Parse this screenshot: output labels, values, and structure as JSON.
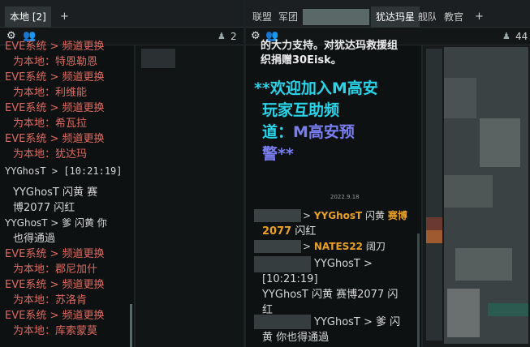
{
  "left_window": {
    "tab_label": "本地 [2]",
    "add_tab": "+",
    "member_count": "2",
    "messages": [
      {
        "type": "sys",
        "line1": "EVE系统 > 频道更换",
        "line2": "为本地：特恩勒恩"
      },
      {
        "type": "sys",
        "line1": "EVE系统 > 频道更换",
        "line2": "为本地：利维能"
      },
      {
        "type": "sys",
        "line1": "EVE系统 > 频道更换",
        "line2": "为本地：希瓦拉"
      },
      {
        "type": "sys",
        "line1": "EVE系统 > 频道更换",
        "line2": "为本地：犹达玛"
      },
      {
        "type": "chat",
        "line1": "YYGhosT > [10:21:19]",
        "line2": "YYGhosT 闪黄 赛",
        "line3": "博2077 闪红"
      },
      {
        "type": "chat",
        "line1": "YYGhosT > 爹 闪黄 你",
        "line2": "也得通過"
      },
      {
        "type": "sys",
        "line1": "EVE系统 > 频道更换",
        "line2": "为本地：郡尼加什"
      },
      {
        "type": "sys",
        "line1": "EVE系统 > 频道更换",
        "line2": "为本地：苏洛肯"
      },
      {
        "type": "sys",
        "line1": "EVE系统 > 频道更换",
        "line2": "为本地：库索蒙莫"
      }
    ]
  },
  "right_window": {
    "tabs": [
      "联盟",
      "军团",
      "犹达玛星",
      "舰队",
      "教官"
    ],
    "active_tab": "犹达玛星",
    "add_tab": "+",
    "member_count": "44",
    "top_text_line1": "的大力支持。对犹达玛救援组",
    "top_text_line2": "织捐赠30Eisk。",
    "banner_lines": [
      "**欢迎加入M高安",
      "玩家互助频",
      "道：",
      "M高安预",
      "警**"
    ],
    "date_note": "2022.9.18",
    "chat": [
      {
        "sep": ">",
        "parts": [
          "YYGhosT",
          " 闪黄 ",
          "赛博",
          "2077",
          " 闪红"
        ]
      },
      {
        "sep": ">",
        "parts": [
          "NATES22",
          " 阔刀"
        ]
      },
      {
        "sep": ">",
        "speaker": "YYGhosT >",
        "time": "[10:21:19]",
        "body1": "YYGhosT 闪黄 赛博2077 闪",
        "body2": "红"
      },
      {
        "sep": ">",
        "speaker": "YYGhosT > 爹 闪",
        "body1": "黄 你也得通過"
      }
    ]
  },
  "colors": {
    "system_text": "#e06a60",
    "banner_cyan": "#27d4e8",
    "banner_purple": "#7a7ef0",
    "highlight_orange": "#e8a020"
  }
}
